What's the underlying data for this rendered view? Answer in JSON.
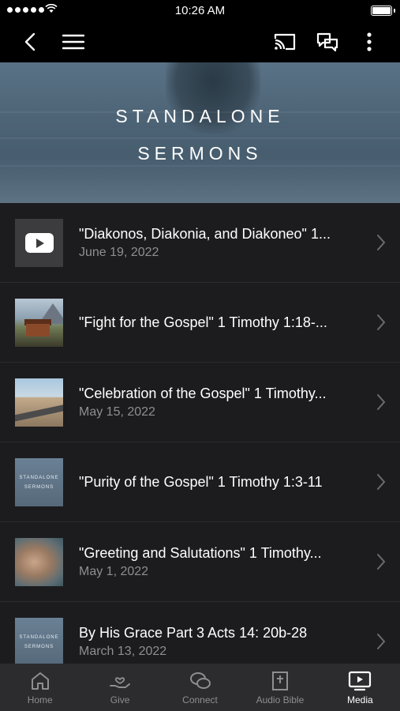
{
  "status_bar": {
    "time": "10:26 AM"
  },
  "nav": {
    "back_icon": "chevron-left-icon",
    "menu_icon": "hamburger-icon",
    "cast_icon": "cast-icon",
    "chat_icon": "chat-icon",
    "more_icon": "more-vertical-icon"
  },
  "hero": {
    "line1": "STANDALONE",
    "line2": "SERMONS"
  },
  "items": [
    {
      "title": "\"Diakonos, Diakonia, and Diakoneo\" 1...",
      "date": "June 19, 2022",
      "thumb": "youtube-icon"
    },
    {
      "title": "\"Fight for the Gospel\" 1 Timothy 1:18-...",
      "date": "",
      "thumb": "cabin-photo"
    },
    {
      "title": "\"Celebration of the Gospel\" 1 Timothy...",
      "date": "May 15, 2022",
      "thumb": "road-photo"
    },
    {
      "title": "\"Purity of the Gospel\" 1 Timothy 1:3-11",
      "date": "",
      "thumb": "standalone-sermons-artwork"
    },
    {
      "title": "\"Greeting and Salutations\" 1 Timothy...",
      "date": "May 1, 2022",
      "thumb": "cliff-photo"
    },
    {
      "title": "By His Grace Part 3 Acts 14: 20b-28",
      "date": "March 13, 2022",
      "thumb": "standalone-sermons-artwork"
    }
  ],
  "thumb_text": {
    "line1": "STANDALONE",
    "line2": "SERMONS"
  },
  "tabs": [
    {
      "label": "Home",
      "icon": "home-icon"
    },
    {
      "label": "Give",
      "icon": "give-icon"
    },
    {
      "label": "Connect",
      "icon": "connect-icon"
    },
    {
      "label": "Audio Bible",
      "icon": "bible-icon"
    },
    {
      "label": "Media",
      "icon": "media-icon",
      "active": true
    }
  ],
  "colors": {
    "background": "#1c1c1e",
    "tabbar": "#2c2c2e",
    "muted": "#8e8e93",
    "navbar": "#000000"
  }
}
